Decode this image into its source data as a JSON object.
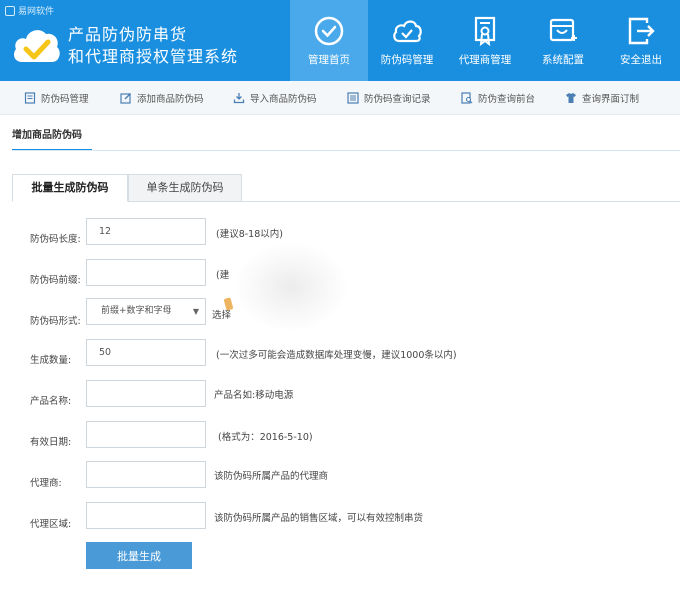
{
  "header": {
    "brand_tag": "易网软件",
    "title_line1": "产品防伪防串货",
    "title_line2": "和代理商授权管理系统",
    "nav": [
      {
        "label": "管理首页",
        "icon": "check-circle-icon",
        "active": true
      },
      {
        "label": "防伪码管理",
        "icon": "cloud-check-icon",
        "active": false
      },
      {
        "label": "代理商管理",
        "icon": "certificate-icon",
        "active": false
      },
      {
        "label": "系统配置",
        "icon": "config-icon",
        "active": false
      },
      {
        "label": "安全退出",
        "icon": "logout-icon",
        "active": false
      }
    ]
  },
  "subnav": [
    {
      "label": "防伪码管理",
      "icon": "document-icon"
    },
    {
      "label": "添加商品防伪码",
      "icon": "edit-icon"
    },
    {
      "label": "导入商品防伪码",
      "icon": "import-icon"
    },
    {
      "label": "防伪码查询记录",
      "icon": "list-icon"
    },
    {
      "label": "防伪查询前台",
      "icon": "search-doc-icon"
    },
    {
      "label": "查询界面订制",
      "icon": "shirt-icon"
    }
  ],
  "section_title": "增加商品防伪码",
  "tabs": {
    "batch": "批量生成防伪码",
    "single": "单条生成防伪码"
  },
  "form": {
    "code_length": {
      "label": "防伪码长度:",
      "value": "12",
      "hint": "(建议8-18以内)"
    },
    "prefix": {
      "label": "防伪码前缀:",
      "value": "",
      "hint": "(建"
    },
    "format": {
      "label": "防伪码形式:",
      "selected": "前缀+数字和字母",
      "hint": "选择"
    },
    "quantity": {
      "label": "生成数量:",
      "value": "50",
      "hint": "(一次过多可能会造成数据库处理变慢，建议1000条以内)"
    },
    "product_name": {
      "label": "产品名称:",
      "value": "",
      "hint": "产品名如:移动电源"
    },
    "valid_date": {
      "label": "有效日期:",
      "value": "",
      "hint": "(格式为：2016-5-10)"
    },
    "agent": {
      "label": "代理商:",
      "value": "",
      "hint": "该防伪码所属产品的代理商"
    },
    "agent_region": {
      "label": "代理区域:",
      "value": "",
      "hint": "该防伪码所属产品的销售区域，可以有效控制串货"
    }
  },
  "submit_label": "批量生成",
  "colors": {
    "header_bg": "#1a8fe0",
    "nav_active": "#4aa9ea",
    "button": "#4a9ad8"
  }
}
